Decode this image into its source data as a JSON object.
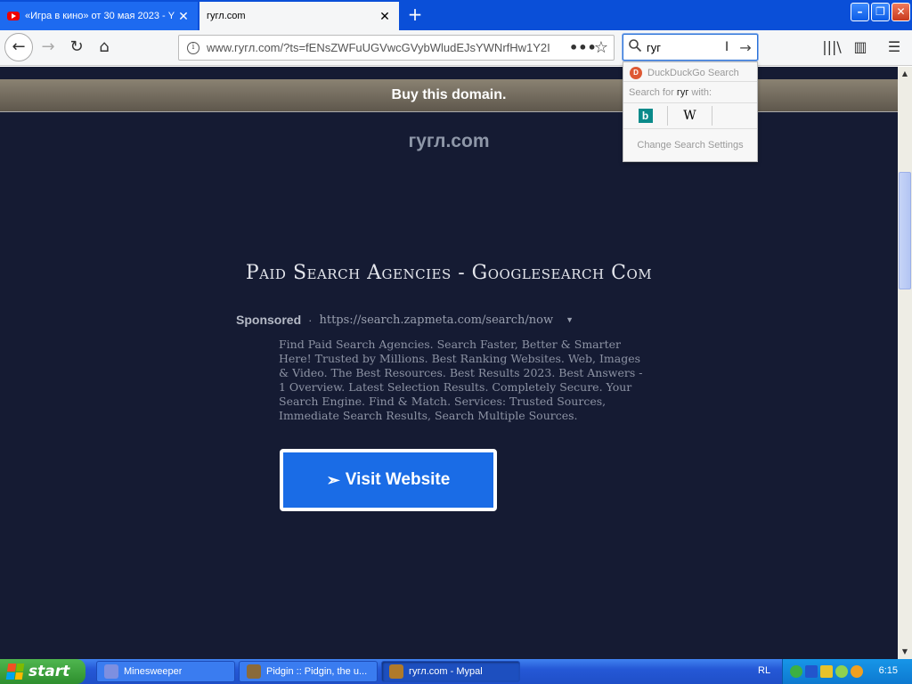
{
  "tabs": [
    {
      "title": "«Игра в кино» от 30 мая 2023 - Y",
      "close": "✕",
      "active": false
    },
    {
      "title": "гугл.com",
      "close": "✕",
      "active": true
    }
  ],
  "newtab_glyph": "+",
  "window_buttons": {
    "minimize": "–",
    "restore": "❐",
    "close": "✕"
  },
  "navbar": {
    "back": "←",
    "forward": "→",
    "reload": "↻",
    "home": "⌂",
    "url": "www.гугл.com/?ts=fENsZWFuUGVwcGVybWludEJsYWNrfHw1Y2I",
    "info": "i",
    "page_actions": "•••",
    "bookmark": "☆",
    "search_value": "гуг",
    "search_caret": "I",
    "search_go": "→",
    "library": "|||\\",
    "sidebar": "▥",
    "menu": "☰"
  },
  "search_dropdown": {
    "engine": "DuckDuckGo Search",
    "search_for_prefix": "Search for ",
    "search_for_term": "гуг",
    "search_for_suffix": " with:",
    "engines": [
      {
        "name": "bing-icon",
        "glyph": "b"
      },
      {
        "name": "wikipedia-icon",
        "glyph": "W"
      }
    ],
    "settings": "Change Search Settings"
  },
  "page": {
    "banner": "Buy this domain.",
    "domain": "гугл.com",
    "ad_title": "Paid Search Agencies - Googlesearch Com",
    "sponsored": "Sponsored",
    "separator": "·",
    "ad_url": "https://search.zapmeta.com/search/now",
    "ad_dropdown": "▼",
    "ad_description": "Find Paid Search Agencies. Search Faster, Better & Smarter Here! Trusted by Millions. Best Ranking Websites. Web, Images & Video. The Best Resources. Best Results 2023. Best Answers - 1 Overview. Latest Selection Results. Completely Secure. Your Search Engine. Find & Match. Services: Trusted Sources, Immediate Search Results, Search Multiple Sources.",
    "visit_arrow": "➣",
    "visit_label": "Visit Website"
  },
  "scrollbar": {
    "up": "▲",
    "down": "▼"
  },
  "taskbar": {
    "start": "start",
    "items": [
      {
        "label": "Minesweeper",
        "color": "#7d8fe0"
      },
      {
        "label": "Pidgin :: Pidgin, the u...",
        "color": "#8a6a3a"
      },
      {
        "label": "гугл.com - Mypal",
        "color": "#b07a2a"
      }
    ],
    "lang": "RL",
    "clock": "6:15"
  },
  "colors": {
    "page_bg": "#151b33",
    "button_blue": "#1a6ce6",
    "taskbar_blue": "#2558d6",
    "start_green": "#3a9f3a"
  }
}
